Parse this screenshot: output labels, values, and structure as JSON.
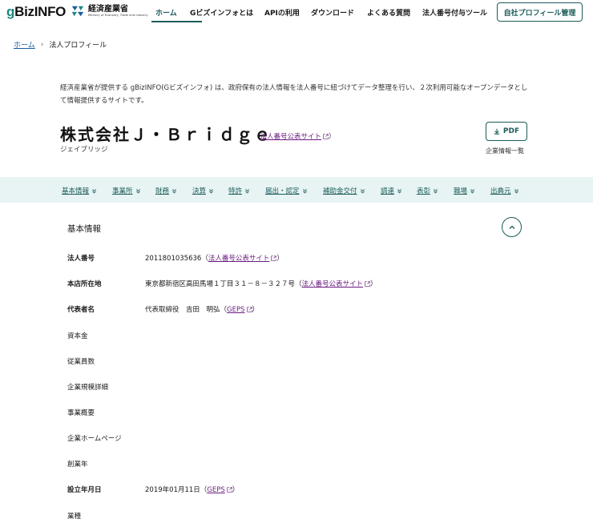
{
  "header": {
    "logo_g": "g",
    "logo_rest": "BizINFO",
    "meti_jp": "経済産業省",
    "meti_en": "Ministry of Economy, Trade and Industry",
    "nav": [
      {
        "label": "ホーム",
        "active": true
      },
      {
        "label": "Gビズインフォとは"
      },
      {
        "label": "APIの利用"
      },
      {
        "label": "ダウンロード"
      },
      {
        "label": "よくある質問"
      },
      {
        "label": "法人番号付与ツール"
      }
    ],
    "profile_button": "自社プロフィール管理"
  },
  "breadcrumb": {
    "home": "ホーム",
    "sep": "›",
    "current": "法人プロフィール"
  },
  "intro": "経済産業省が提供する gBizINFO(Gビズインフォ) は、政府保有の法人情報を法人番号に紐づけてデータ整理を行い、２次利用可能なオープンデータとして情報提供するサイトです。",
  "company": {
    "name": "株式会社Ｊ・Ｂｒｉｄｇｅ",
    "kana": "ジェイブリッジ",
    "link_open": "（",
    "link_label": "法人番号公表サイト",
    "link_close": "）"
  },
  "pdf": {
    "label": "PDF",
    "list_label": "企業情報一覧"
  },
  "tabs": [
    "基本情報",
    "事業所",
    "財務",
    "決算",
    "特許",
    "届出・認定",
    "補助金交付",
    "調達",
    "表彰",
    "職場",
    "出典元"
  ],
  "section": {
    "title": "基本情報"
  },
  "rows": [
    {
      "label": "法人番号",
      "bold": true,
      "value": "2011801035636",
      "link": "法人番号公表サイト"
    },
    {
      "label": "本店所在地",
      "bold": true,
      "value": "東京都新宿区高田馬場１丁目３１－８－３２７号",
      "link": "法人番号公表サイト"
    },
    {
      "label": "代表者名",
      "bold": true,
      "value": "代表取締役　吉田　明弘",
      "link": "GEPS"
    },
    {
      "label": "資本金",
      "bold": false,
      "value": "",
      "link": ""
    },
    {
      "label": "従業員数",
      "bold": false,
      "value": "",
      "link": ""
    },
    {
      "label": "企業規模詳細",
      "bold": false,
      "value": "",
      "link": ""
    },
    {
      "label": "事業概要",
      "bold": false,
      "value": "",
      "link": ""
    },
    {
      "label": "企業ホームページ",
      "bold": false,
      "value": "",
      "link": ""
    },
    {
      "label": "創業年",
      "bold": false,
      "value": "",
      "link": ""
    },
    {
      "label": "設立年月日",
      "bold": true,
      "value": "2019年01月11日",
      "link": "GEPS"
    },
    {
      "label": "業種",
      "bold": false,
      "value": "",
      "link": ""
    }
  ],
  "colors": {
    "accent": "#1a5c5a",
    "link_visited": "#6a1b7f",
    "tab_bg": "#e8f4f3",
    "logo_green": "#1b8a7e"
  }
}
